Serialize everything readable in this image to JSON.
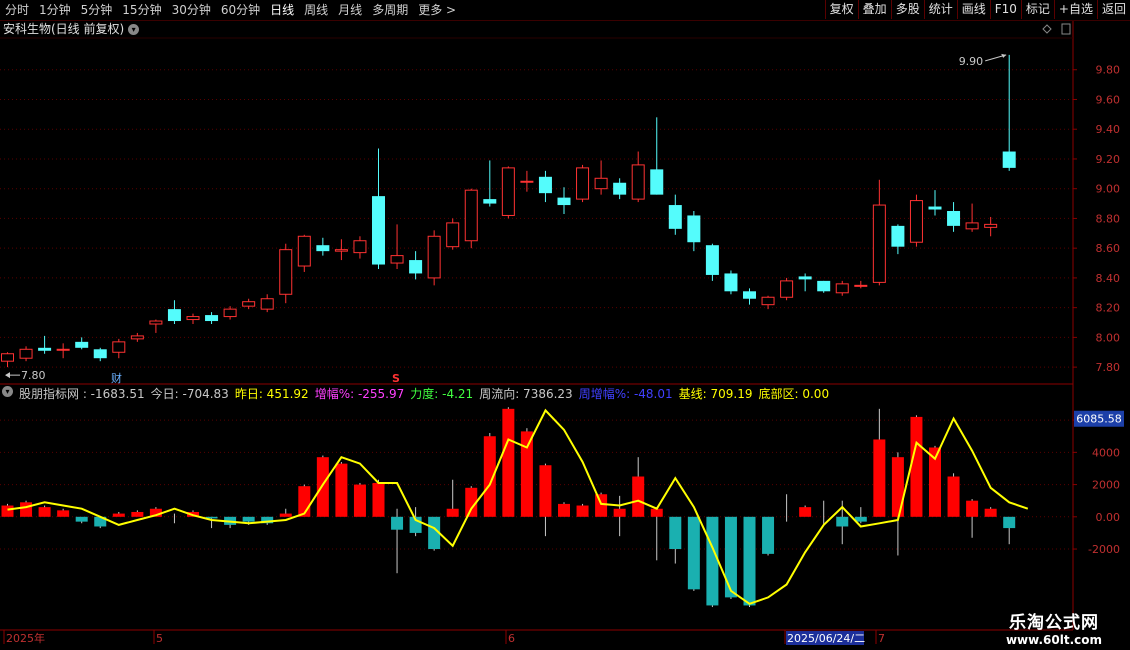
{
  "toolbar": {
    "periods": [
      "分时",
      "1分钟",
      "5分钟",
      "15分钟",
      "30分钟",
      "60分钟",
      "日线",
      "周线",
      "月线",
      "多周期",
      "更多 >"
    ],
    "active_period": "日线",
    "right_buttons": [
      "复权",
      "叠加",
      "多股",
      "统计",
      "画线",
      "F10",
      "标记",
      "+自选",
      "返回"
    ]
  },
  "stock": {
    "title": "安科生物(日线 前复权)"
  },
  "markers": {
    "high_label": "9.90",
    "low_label": "7.80",
    "cai": "财",
    "s": "S"
  },
  "colors": {
    "up": "#ff3232",
    "down": "#54fcfc",
    "yellow": "#ffff00",
    "grid": "#8b0000",
    "axis_text": "#c03030"
  },
  "indicator": {
    "items": [
      {
        "label": "股朋指标网 : -1683.51",
        "color": "#c8c8c8"
      },
      {
        "label": "今日: -704.83",
        "color": "#c8c8c8"
      },
      {
        "label": "昨日: 451.92",
        "color": "#ffff00"
      },
      {
        "label": "增幅%: -255.97",
        "color": "#ff40ff"
      },
      {
        "label": "力度: -4.21",
        "color": "#40ff40"
      },
      {
        "label": "周流向: 7386.23",
        "color": "#c8c8c8"
      },
      {
        "label": "周增幅%: -48.01",
        "color": "#4040ff"
      },
      {
        "label": "基线: 709.19",
        "color": "#ffff00"
      },
      {
        "label": "底部区: 0.00",
        "color": "#ffff00"
      }
    ],
    "current_value_tag": "6085.58"
  },
  "date_axis": {
    "labels": [
      "2025年",
      "5",
      "6",
      "2025/06/24/二",
      "7"
    ]
  },
  "watermark": {
    "line1": "乐淘公式网",
    "line2": "www.60lt.com"
  },
  "chart_data": [
    {
      "type": "candlestick",
      "title": "安科生物(日线 前复权)",
      "ylim": [
        7.7,
        10.0
      ],
      "yticks": [
        7.8,
        8.0,
        8.2,
        8.4,
        8.6,
        8.8,
        9.0,
        9.2,
        9.4,
        9.6,
        9.8
      ],
      "candles": [
        {
          "o": 7.84,
          "h": 7.9,
          "l": 7.8,
          "c": 7.89
        },
        {
          "o": 7.86,
          "h": 7.94,
          "l": 7.84,
          "c": 7.92
        },
        {
          "o": 7.93,
          "h": 8.01,
          "l": 7.89,
          "c": 7.91
        },
        {
          "o": 7.92,
          "h": 7.96,
          "l": 7.86,
          "c": 7.92
        },
        {
          "o": 7.97,
          "h": 8.0,
          "l": 7.92,
          "c": 7.93
        },
        {
          "o": 7.92,
          "h": 7.93,
          "l": 7.84,
          "c": 7.86
        },
        {
          "o": 7.9,
          "h": 7.99,
          "l": 7.86,
          "c": 7.97
        },
        {
          "o": 7.99,
          "h": 8.03,
          "l": 7.97,
          "c": 8.01
        },
        {
          "o": 8.09,
          "h": 8.12,
          "l": 8.03,
          "c": 8.11
        },
        {
          "o": 8.19,
          "h": 8.25,
          "l": 8.09,
          "c": 8.11
        },
        {
          "o": 8.12,
          "h": 8.16,
          "l": 8.09,
          "c": 8.14
        },
        {
          "o": 8.15,
          "h": 8.17,
          "l": 8.09,
          "c": 8.11
        },
        {
          "o": 8.14,
          "h": 8.21,
          "l": 8.12,
          "c": 8.19
        },
        {
          "o": 8.21,
          "h": 8.26,
          "l": 8.19,
          "c": 8.24
        },
        {
          "o": 8.19,
          "h": 8.29,
          "l": 8.17,
          "c": 8.26
        },
        {
          "o": 8.29,
          "h": 8.63,
          "l": 8.23,
          "c": 8.59
        },
        {
          "o": 8.48,
          "h": 8.69,
          "l": 8.44,
          "c": 8.68
        },
        {
          "o": 8.62,
          "h": 8.67,
          "l": 8.55,
          "c": 8.58
        },
        {
          "o": 8.58,
          "h": 8.66,
          "l": 8.52,
          "c": 8.59
        },
        {
          "o": 8.57,
          "h": 8.68,
          "l": 8.53,
          "c": 8.65
        },
        {
          "o": 8.95,
          "h": 9.27,
          "l": 8.46,
          "c": 8.49
        },
        {
          "o": 8.5,
          "h": 8.76,
          "l": 8.46,
          "c": 8.55
        },
        {
          "o": 8.52,
          "h": 8.58,
          "l": 8.39,
          "c": 8.43
        },
        {
          "o": 8.4,
          "h": 8.72,
          "l": 8.35,
          "c": 8.68
        },
        {
          "o": 8.61,
          "h": 8.8,
          "l": 8.59,
          "c": 8.77
        },
        {
          "o": 8.65,
          "h": 9.0,
          "l": 8.6,
          "c": 8.99
        },
        {
          "o": 8.93,
          "h": 9.19,
          "l": 8.88,
          "c": 8.9
        },
        {
          "o": 8.82,
          "h": 9.15,
          "l": 8.8,
          "c": 9.14
        },
        {
          "o": 9.05,
          "h": 9.12,
          "l": 8.98,
          "c": 9.05
        },
        {
          "o": 9.08,
          "h": 9.12,
          "l": 8.91,
          "c": 8.97
        },
        {
          "o": 8.94,
          "h": 9.01,
          "l": 8.83,
          "c": 8.89
        },
        {
          "o": 8.93,
          "h": 9.16,
          "l": 8.91,
          "c": 9.14
        },
        {
          "o": 9.0,
          "h": 9.19,
          "l": 8.96,
          "c": 9.07
        },
        {
          "o": 9.04,
          "h": 9.07,
          "l": 8.93,
          "c": 8.96
        },
        {
          "o": 8.93,
          "h": 9.25,
          "l": 8.91,
          "c": 9.16
        },
        {
          "o": 9.13,
          "h": 9.48,
          "l": 8.96,
          "c": 8.96
        },
        {
          "o": 8.89,
          "h": 8.96,
          "l": 8.69,
          "c": 8.73
        },
        {
          "o": 8.82,
          "h": 8.85,
          "l": 8.58,
          "c": 8.64
        },
        {
          "o": 8.62,
          "h": 8.63,
          "l": 8.38,
          "c": 8.42
        },
        {
          "o": 8.43,
          "h": 8.45,
          "l": 8.29,
          "c": 8.31
        },
        {
          "o": 8.31,
          "h": 8.33,
          "l": 8.22,
          "c": 8.26
        },
        {
          "o": 8.22,
          "h": 8.28,
          "l": 8.19,
          "c": 8.27
        },
        {
          "o": 8.27,
          "h": 8.4,
          "l": 8.25,
          "c": 8.38
        },
        {
          "o": 8.41,
          "h": 8.43,
          "l": 8.31,
          "c": 8.39
        },
        {
          "o": 8.38,
          "h": 8.38,
          "l": 8.3,
          "c": 8.31
        },
        {
          "o": 8.3,
          "h": 8.38,
          "l": 8.28,
          "c": 8.36
        },
        {
          "o": 8.35,
          "h": 8.38,
          "l": 8.33,
          "c": 8.35
        },
        {
          "o": 8.37,
          "h": 9.06,
          "l": 8.35,
          "c": 8.89
        },
        {
          "o": 8.75,
          "h": 8.76,
          "l": 8.56,
          "c": 8.61
        },
        {
          "o": 8.64,
          "h": 8.96,
          "l": 8.61,
          "c": 8.92
        },
        {
          "o": 8.88,
          "h": 8.99,
          "l": 8.82,
          "c": 8.86
        },
        {
          "o": 8.85,
          "h": 8.91,
          "l": 8.71,
          "c": 8.75
        },
        {
          "o": 8.73,
          "h": 8.9,
          "l": 8.71,
          "c": 8.77
        },
        {
          "o": 8.74,
          "h": 8.81,
          "l": 8.68,
          "c": 8.76
        },
        {
          "o": 9.25,
          "h": 9.9,
          "l": 9.12,
          "c": 9.14
        }
      ]
    },
    {
      "type": "bar",
      "title": "股朋指标网",
      "ylim": [
        -6900,
        7000
      ],
      "yticks": [
        -2000,
        0,
        2000,
        4000,
        6000
      ],
      "bars": [
        700,
        900,
        600,
        400,
        -300,
        -600,
        200,
        300,
        500,
        0,
        300,
        -100,
        -500,
        -300,
        -400,
        200,
        1900,
        3700,
        3300,
        2000,
        2100,
        -800,
        -1000,
        -2000,
        500,
        1800,
        5000,
        6700,
        5300,
        3200,
        800,
        700,
        1400,
        500,
        2500,
        500,
        -2000,
        -4500,
        -5500,
        -5000,
        -5500,
        -2300,
        0,
        600,
        0,
        -600,
        -300,
        4800,
        3700,
        6200,
        4300,
        2500,
        1000,
        500,
        -700
      ],
      "wicks_high": [
        800,
        1000,
        700,
        500,
        -100,
        -200,
        300,
        400,
        600,
        200,
        400,
        0,
        -100,
        -100,
        0,
        500,
        2000,
        3800,
        3400,
        2100,
        2300,
        500,
        600,
        -500,
        2300,
        1900,
        5200,
        6800,
        5500,
        3300,
        900,
        800,
        1500,
        1300,
        3700,
        600,
        -400,
        -1000,
        -2000,
        -1400,
        -1500,
        -800,
        1400,
        700,
        1000,
        1000,
        600,
        6700,
        4000,
        6300,
        4400,
        2700,
        1100,
        600,
        -500
      ],
      "wicks_low": [
        600,
        800,
        500,
        300,
        -400,
        -700,
        100,
        200,
        400,
        -400,
        200,
        -700,
        -700,
        -500,
        -500,
        100,
        1800,
        3600,
        3200,
        1900,
        2000,
        -3500,
        -1200,
        -2100,
        400,
        1700,
        4900,
        6600,
        5200,
        -1200,
        700,
        600,
        1300,
        -1200,
        2400,
        -2700,
        -2900,
        -4600,
        -5600,
        -5100,
        -5600,
        -2400,
        -300,
        500,
        -500,
        -1700,
        -400,
        4700,
        -2400,
        6100,
        4200,
        2400,
        -1300,
        400,
        -1700
      ],
      "line_yellow": [
        450,
        600,
        900,
        700,
        500,
        0,
        -500,
        -200,
        100,
        500,
        100,
        -200,
        -300,
        -400,
        -300,
        -200,
        200,
        2000,
        3700,
        3300,
        2100,
        2100,
        -200,
        -700,
        -1800,
        500,
        2000,
        4800,
        4300,
        6600,
        5400,
        3400,
        800,
        700,
        1000,
        500,
        2400,
        600,
        -1900,
        -4600,
        -5400,
        -5000,
        -4200,
        -2200,
        -500,
        600,
        -600,
        -400,
        -200,
        4600,
        3600,
        6100,
        4100,
        1800,
        900,
        500
      ]
    }
  ]
}
